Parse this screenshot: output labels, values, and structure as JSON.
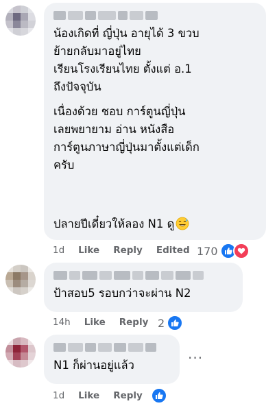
{
  "comments": [
    {
      "text": "น้องเกิดที่ ญี่ปุ่น อายุได้ 3 ขวบ\nย้ายกลับมาอยู่ไทย\nเรียนโรงเรียนไทย ตั้งแต่ อ.1\nถึงปัจจุบัน",
      "text2": "เนื่องด้วย ชอบ การ์ตูนญี่ปุ่น\nเลยพยายาม อ่าน หนังสือ\nการ์ตูนภาษาญี่ปุ่นมาตั้งแต่เด็ก\nครับ",
      "text3": "ปลายปีเดี๋ยวให้ลอง N1 ดู",
      "time": "1d",
      "like": "Like",
      "reply": "Reply",
      "edited": "Edited",
      "reaction_count": "170"
    },
    {
      "text": "ป้าสอบ5 รอบกว่าจะผ่าน N2",
      "time": "14h",
      "like": "Like",
      "reply": "Reply",
      "reaction_count": "2"
    },
    {
      "text": "N1 ก็ผ่านอยู่แล้ว",
      "time": "1d",
      "like": "Like",
      "reply": "Reply",
      "more": "···"
    }
  ],
  "colors": {
    "accent": "#1877f2",
    "love": "#f33e58",
    "bubble": "#f0f2f5",
    "meta": "#65676b"
  },
  "icons": {
    "like": "thumbs-up-icon",
    "love": "heart-icon",
    "emoji": "grinning-sweat-emoji",
    "more": "more-options-icon"
  }
}
